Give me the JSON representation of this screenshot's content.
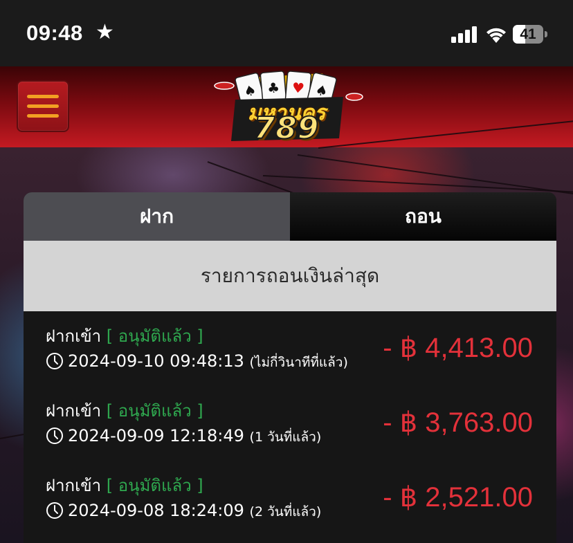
{
  "status_bar": {
    "time": "09:48",
    "star": "★",
    "battery_level": "41",
    "battery_fraction": 0.41,
    "icons": [
      "cellular-signal-icon",
      "wifi-icon",
      "battery-icon"
    ]
  },
  "header": {
    "menu_icon": "hamburger-menu-icon",
    "logo_text_top": "มหานคร",
    "logo_text_number": "789",
    "colors": {
      "header_red": "#c41a22",
      "menu_orange": "#f2a023"
    }
  },
  "tabs": [
    {
      "label": "ฝาก",
      "active": false
    },
    {
      "label": "ถอน",
      "active": true
    }
  ],
  "section_title": "รายการถอนเงินล่าสุด",
  "transactions": [
    {
      "type": "ฝากเข้า",
      "status": "[ อนุมัติแล้ว ]",
      "datetime": "2024-09-10 09:48:13",
      "ago": "(ไม่กี่วินาทีที่แล้ว)",
      "amount": "- ฿ 4,413.00"
    },
    {
      "type": "ฝากเข้า",
      "status": "[ อนุมัติแล้ว ]",
      "datetime": "2024-09-09 12:18:49",
      "ago": "(1 วันที่แล้ว)",
      "amount": "- ฿ 3,763.00"
    },
    {
      "type": "ฝากเข้า",
      "status": "[ อนุมัติแล้ว ]",
      "datetime": "2024-09-08 18:24:09",
      "ago": "(2 วันที่แล้ว)",
      "amount": "- ฿ 2,521.00"
    }
  ],
  "colors": {
    "status_green": "#2fa84f",
    "amount_red": "#e3313a"
  }
}
